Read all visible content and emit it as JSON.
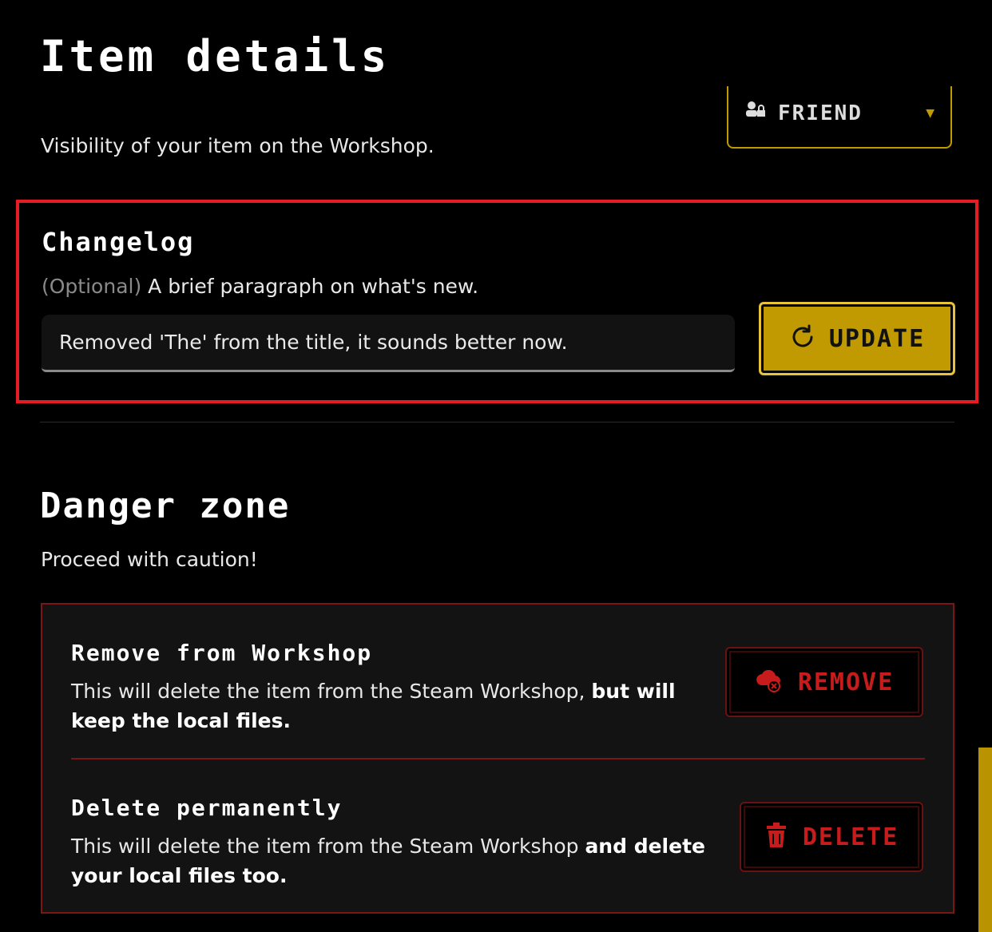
{
  "page": {
    "title": "Item details"
  },
  "visibility": {
    "selected": "FRIEND",
    "description": "Visibility of your item on the Workshop."
  },
  "changelog": {
    "title": "Changelog",
    "optional_tag": "(Optional)",
    "description": "A brief paragraph on what's new.",
    "input_value": "Removed 'The' from the title, it sounds better now.",
    "update_label": "UPDATE"
  },
  "danger_zone": {
    "title": "Danger zone",
    "description": "Proceed with caution!",
    "remove": {
      "title": "Remove from Workshop",
      "desc_plain": "This will delete the item from the Steam Workshop, ",
      "desc_bold": "but will keep the local files.",
      "button_label": "REMOVE"
    },
    "delete": {
      "title": "Delete permanently",
      "desc_plain": "This will delete the item from the Steam Workshop ",
      "desc_bold": "and delete your local files too.",
      "button_label": "DELETE"
    }
  },
  "colors": {
    "accent": "#c19a02",
    "danger": "#c81b1b",
    "highlight_border": "#e81d23"
  }
}
